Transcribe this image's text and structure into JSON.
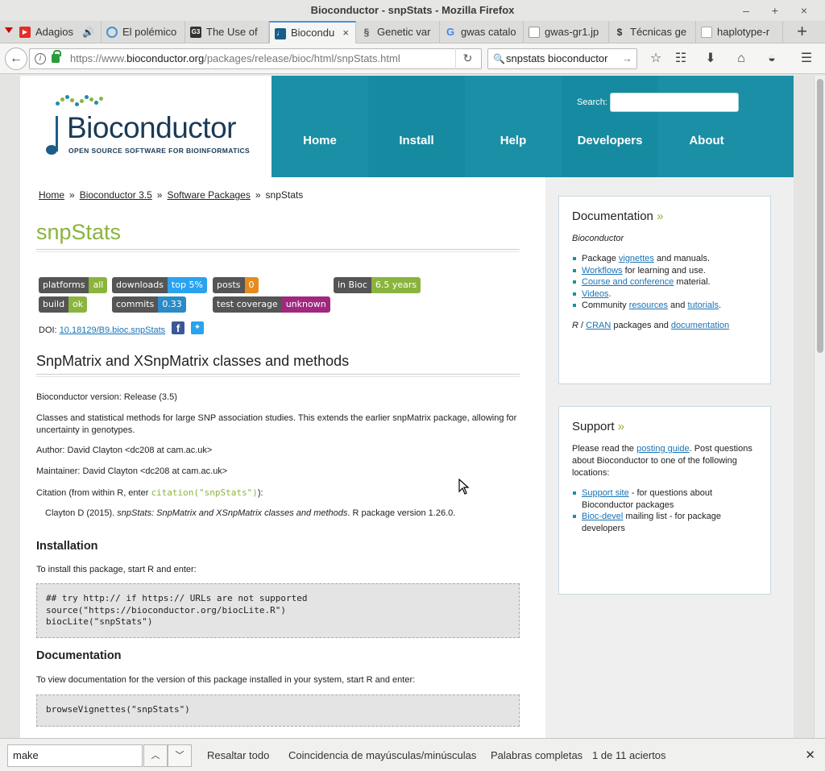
{
  "window": {
    "title": "Bioconductor - snpStats - Mozilla Firefox",
    "controls": "– + ×"
  },
  "tabs": [
    {
      "label": "Adagios",
      "icon": "youtube-icon",
      "color": "#e52d27"
    },
    {
      "label": "El polémico",
      "icon": "loading-icon",
      "color": "#4a90d9"
    },
    {
      "label": "The Use of",
      "icon": "g3-icon",
      "color": "#333333"
    },
    {
      "label": "Biocondu",
      "icon": "bioconductor-icon",
      "color": "#1a5d8a"
    },
    {
      "label": "Genetic var",
      "icon": "dna-icon",
      "color": "#555555"
    },
    {
      "label": "gwas catalo",
      "icon": "google-icon",
      "color": "#4285f4"
    },
    {
      "label": "gwas-gr1.jp",
      "icon": "image-icon",
      "color": "#777777"
    },
    {
      "label": "Técnicas ge",
      "icon": "scholar-icon",
      "color": "#333333"
    },
    {
      "label": "haplotype-r",
      "icon": "page-icon",
      "color": "#999999"
    }
  ],
  "nav": {
    "url_scheme": "https://www.",
    "url_host": "bioconductor.org",
    "url_path": "/packages/release/bioc/html/snpStats.html",
    "search_value": "snpstats bioconductor"
  },
  "site": {
    "logo_title": "Bioconductor",
    "logo_tagline": "OPEN SOURCE SOFTWARE FOR BIOINFORMATICS",
    "nav": [
      "Home",
      "Install",
      "Help",
      "Developers",
      "About"
    ],
    "search_label": "Search:"
  },
  "breadcrumb": [
    "Home",
    "Bioconductor 3.5",
    "Software Packages",
    "snpStats"
  ],
  "breadcrumb_sep": "»",
  "package": {
    "name": "snpStats",
    "badges": [
      {
        "label": "platforms",
        "value": "all",
        "color": "#8ab43d"
      },
      {
        "label": "downloads",
        "value": "top 5%",
        "color": "#2aa3ef"
      },
      {
        "label": "posts",
        "value": "0",
        "color": "#e78a1f"
      },
      {
        "label": "in Bioc",
        "value": "6.5 years",
        "color": "#8ab43d"
      },
      {
        "label": "build",
        "value": "ok",
        "color": "#8ab43d"
      },
      {
        "label": "commits",
        "value": "0.33",
        "color": "#2a8bc5"
      },
      {
        "label": "test coverage",
        "value": "unknown",
        "color": "#a0287f"
      }
    ],
    "doi_label": "DOI:",
    "doi": "10.18129/B9.bioc.snpStats",
    "subtitle": "SnpMatrix and XSnpMatrix classes and methods",
    "version_line": "Bioconductor version: Release (3.5)",
    "description": "Classes and statistical methods for large SNP association studies. This extends the earlier snpMatrix package, allowing for uncertainty in genotypes.",
    "author": "Author: David Clayton <dc208 at cam.ac.uk>",
    "maintainer": "Maintainer: David Clayton <dc208 at cam.ac.uk>",
    "citation_pre": "Citation (from within R, enter ",
    "citation_code": "citation(\"snpStats\")",
    "citation_post": "):",
    "citation_author": "Clayton D (2015). ",
    "citation_title": "snpStats: SnpMatrix and XSnpMatrix classes and methods",
    "citation_rest": ". R package version 1.26.0.",
    "install_heading": "Installation",
    "install_text": "To install this package, start R and enter:",
    "install_code": "## try http:// if https:// URLs are not supported\nsource(\"https://bioconductor.org/biocLite.R\")\nbiocLite(\"snpStats\")",
    "doc_heading": "Documentation",
    "doc_text": "To view documentation for the version of this package installed in your system, start R and enter:",
    "doc_code": "browseVignettes(\"snpStats\")"
  },
  "sidebar": {
    "documentation": {
      "title": "Documentation",
      "raquo": "»",
      "subtitle": "Bioconductor",
      "items": [
        {
          "pre": "Package ",
          "link": "vignettes",
          "post": " and manuals."
        },
        {
          "pre": "",
          "link": "Workflows",
          "post": " for learning and use."
        },
        {
          "pre": "",
          "link": "Course and conference",
          "post": " material."
        },
        {
          "pre": "",
          "link": "Videos",
          "post": "."
        },
        {
          "pre": "Community ",
          "link": "resources",
          "mid": " and ",
          "link2": "tutorials",
          "post": "."
        }
      ],
      "footer_pre": "R",
      "footer_sep": " / ",
      "footer_link1": "CRAN",
      "footer_mid": " packages and ",
      "footer_link2": "documentation"
    },
    "support": {
      "title": "Support",
      "raquo": "»",
      "intro_pre": "Please read the ",
      "intro_link": "posting guide",
      "intro_post": ". Post questions about Bioconductor to one of the following locations:",
      "items": [
        {
          "link": "Support site",
          "post": " - for questions about Bioconductor packages"
        },
        {
          "link": "Bioc-devel",
          "post": " mailing list - for package developers"
        }
      ]
    }
  },
  "findbar": {
    "value": "make",
    "highlight_all": "Resaltar todo",
    "match_case": "Coincidencia de mayúsculas/minúsculas",
    "whole_words": "Palabras completas",
    "result": "1 de 11 aciertos"
  }
}
